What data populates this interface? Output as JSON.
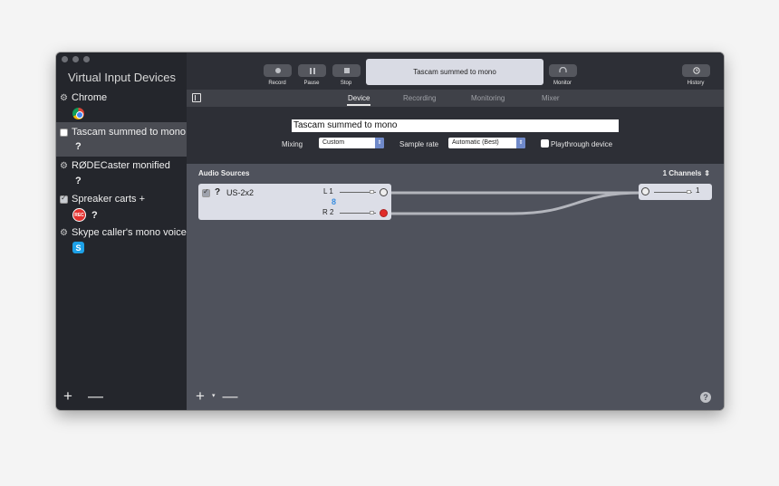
{
  "sidebar": {
    "title": "Virtual Input Devices",
    "devices": [
      {
        "name": "Chrome",
        "icon": "chrome-icon"
      },
      {
        "name": "Tascam summed to mono",
        "icon": "question-icon"
      },
      {
        "name": "RØDECaster monified",
        "icon": "question-icon"
      },
      {
        "name": "Spreaker carts +",
        "icon": "rec-icon"
      },
      {
        "name": "Skype caller's mono voice",
        "icon": "skype-icon"
      }
    ],
    "rec_badge": "REC",
    "question": "?",
    "footer": {
      "add": "+",
      "remove": "—"
    }
  },
  "toolbar": {
    "record": "Record",
    "pause": "Pause",
    "stop": "Stop",
    "display": "Tascam summed to mono",
    "monitor": "Monitor",
    "history": "History"
  },
  "tabs": [
    "Device",
    "Recording",
    "Monitoring",
    "Mixer"
  ],
  "device": {
    "name_value": "Tascam summed to mono",
    "mixing_label": "Mixing",
    "mixing_value": "Custom",
    "sample_rate_label": "Sample rate",
    "sample_rate_value": "Automatic (Best)",
    "playthrough_label": "Playthrough device"
  },
  "sources": {
    "title": "Audio Sources",
    "channels": "1 Channels",
    "source_name": "US-2x2",
    "left": "L 1",
    "right": "R 2",
    "output": "1",
    "footer": {
      "add": "+",
      "remove": "—"
    },
    "help": "?"
  }
}
